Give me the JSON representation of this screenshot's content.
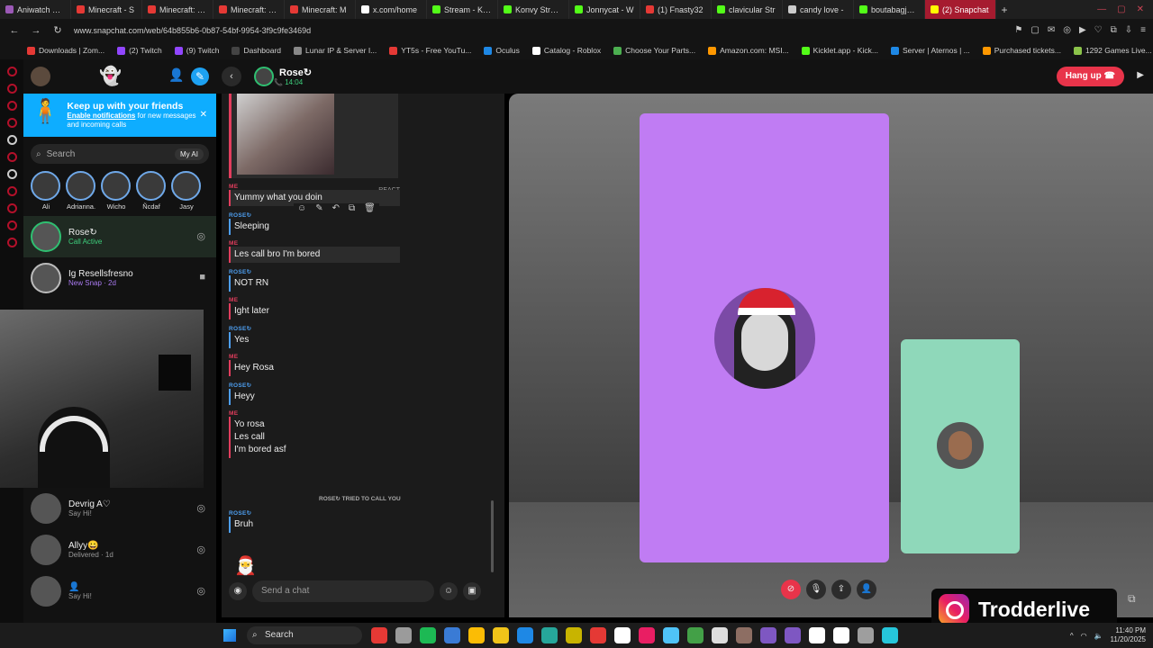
{
  "browser": {
    "tabs": [
      {
        "title": "Aniwatch Free",
        "color": "#9b59b6"
      },
      {
        "title": "Minecraft - S",
        "color": "#e53935"
      },
      {
        "title": "Minecraft: Ho",
        "color": "#e53935"
      },
      {
        "title": "Minecraft: Ho",
        "color": "#e53935"
      },
      {
        "title": "Minecraft: M",
        "color": "#e53935"
      },
      {
        "title": "x.com/home",
        "color": "#ffffff"
      },
      {
        "title": "Stream - Kick",
        "color": "#53fc18"
      },
      {
        "title": "Konvy Stream",
        "color": "#53fc18"
      },
      {
        "title": "Jonnycat - W",
        "color": "#53fc18"
      },
      {
        "title": "(1) Fnasty32",
        "color": "#e53935"
      },
      {
        "title": "clavicular Str",
        "color": "#53fc18"
      },
      {
        "title": "candy love -",
        "color": "#cccccc"
      },
      {
        "title": "boutabagjose",
        "color": "#53fc18"
      },
      {
        "title": "(2) Snapchat",
        "color": "#fffc00"
      }
    ],
    "url": "www.snapchat.com/web/64b855b6-0b87-54bf-9954-3f9c9fe3469d",
    "bookmarks": [
      "Downloads | Zom...",
      "(2) Twitch",
      "(9) Twitch",
      "Dashboard",
      "Lunar IP & Server I...",
      "YT5s - Free YouTu...",
      "Oculus",
      "Catalog - Roblox",
      "Choose Your Parts...",
      "Amazon.com: MSI...",
      "Kicklet.app - Kick...",
      "Server | Aternos | ...",
      "Purchased tickets...",
      "1292 Games Live...",
      "Home"
    ]
  },
  "snap": {
    "banner": {
      "title": "Keep up with your friends",
      "link": "Enable notifications",
      "rest": " for new messages and incoming calls"
    },
    "search_placeholder": "Search",
    "myai": "My AI",
    "stories": [
      "Ali",
      "Adrianna.",
      "Wicho",
      "Ñcdaf",
      "Jasy"
    ],
    "chats_top": [
      {
        "name": "Rose↻",
        "status": "Call Active",
        "kind": "active"
      },
      {
        "name": "Ig Resellsfresno",
        "status": "New Snap · 2d",
        "kind": "new"
      }
    ],
    "chats_bottom": [
      {
        "name": "Devrig A♡",
        "status": "Say Hi!"
      },
      {
        "name": "Allyy😀",
        "status": "Delivered · 1d"
      },
      {
        "name": "👤",
        "status": "Say Hi!"
      }
    ],
    "chat": {
      "name": "Rose↻",
      "call_time": "14:04",
      "hangup": "Hang up",
      "react": "REACT",
      "messages": [
        {
          "from": "ME",
          "text": "Yummy what you doin",
          "kind": "me",
          "hl": true
        },
        {
          "from": "ROSE↻",
          "text": "Sleeping",
          "kind": "rose"
        },
        {
          "from": "ME",
          "text": "Les call bro I'm bored",
          "kind": "me",
          "hl": true
        },
        {
          "from": "ROSE↻",
          "text": "NOT RN",
          "kind": "rose"
        },
        {
          "from": "ME",
          "text": "Ight later",
          "kind": "me"
        },
        {
          "from": "ROSE↻",
          "text": "Yes",
          "kind": "rose"
        },
        {
          "from": "ME",
          "text": "Hey Rosa",
          "kind": "me"
        },
        {
          "from": "ROSE↻",
          "text": "Heyy",
          "kind": "rose"
        },
        {
          "from": "ME",
          "text": "Yo rosa\nLes call\nI'm bored asf",
          "kind": "me"
        }
      ],
      "tried": "ROSE↻ TRIED TO CALL YOU",
      "last": {
        "from": "ROSE↻",
        "text": "Bruh"
      },
      "composer_placeholder": "Send a chat"
    }
  },
  "overlay": {
    "brand": "Trodderlive"
  },
  "taskbar": {
    "search": "Search",
    "time": "11:40 PM",
    "date": "11/20/2025",
    "apps": [
      "#e53935",
      "#9b9b9b",
      "#1db954",
      "#3a7bd5",
      "#fbbc05",
      "#f0c419",
      "#1e88e5",
      "#26a69a",
      "#c8b400",
      "#e53935",
      "#ffffff",
      "#e91e63",
      "#4fc3f7",
      "#43a047",
      "#dddddd",
      "#8d6e63",
      "#7e57c2",
      "#7e57c2",
      "#ffffff",
      "#ffffff",
      "#9e9e9e",
      "#26c6da"
    ]
  },
  "colors": {
    "accent_me": "#e23d5d",
    "accent_rose": "#4d9ef0",
    "tile_a": "#c07cf3",
    "tile_b": "#8fd8ba",
    "hangup": "#e8344a"
  }
}
